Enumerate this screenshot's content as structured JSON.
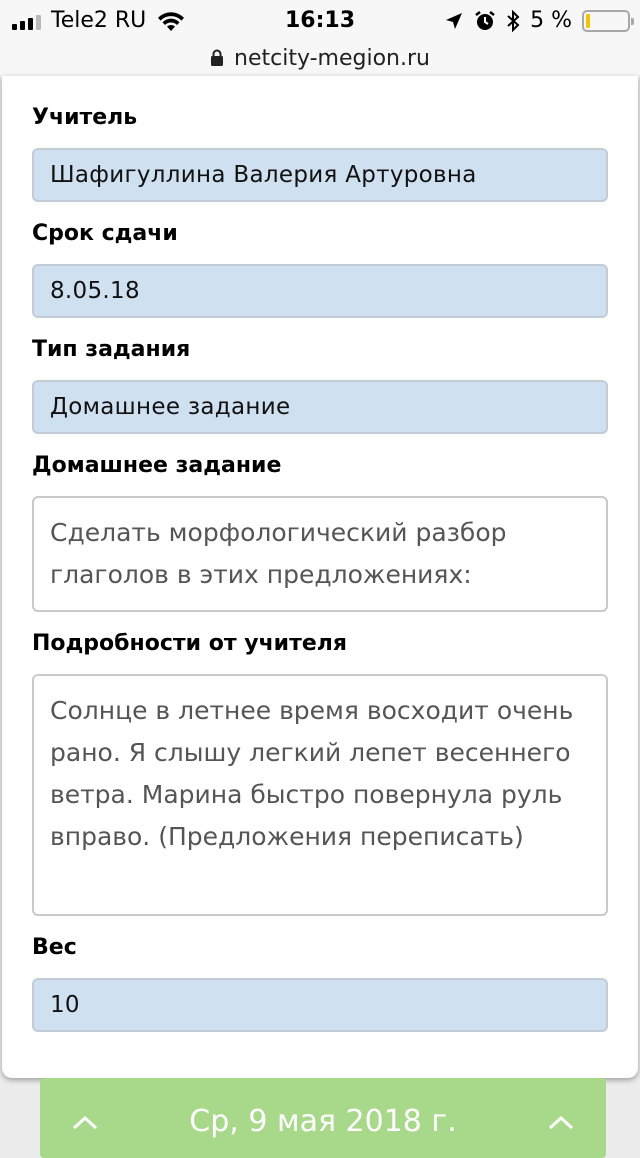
{
  "status_bar": {
    "carrier": "Tele2 RU",
    "time": "16:13",
    "battery_percent": "5 %"
  },
  "url_bar": {
    "url": "netcity-megion.ru"
  },
  "form": {
    "teacher_label": "Учитель",
    "teacher_value": "Шафигуллина Валерия Артуровна",
    "due_label": "Срок сдачи",
    "due_value": "8.05.18",
    "type_label": "Тип задания",
    "type_value": "Домашнее задание",
    "homework_label": "Домашнее задание",
    "homework_value": "Сделать морфологический разбор глаголов в этих предложениях:",
    "details_label": "Подробности от учителя",
    "details_value": "Солнце в летнее время восходит очень рано. Я слышу легкий лепет весеннего ветра. Марина быстро повернула руль вправо. (Предложения переписать)",
    "weight_label": "Вес",
    "weight_value": "10"
  },
  "date_bar": {
    "label": "Ср, 9 мая 2018 г."
  },
  "colors": {
    "field_bg": "#cfe0f0",
    "date_bar_bg": "#a8d98a",
    "battery_low": "#f0c400"
  }
}
